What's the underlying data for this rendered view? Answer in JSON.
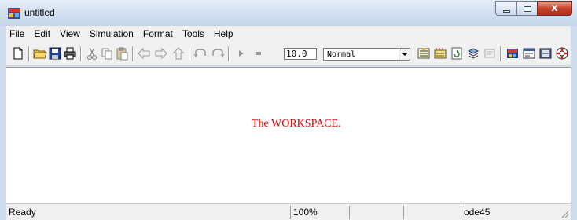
{
  "window": {
    "title": "untitled",
    "icons": {
      "app": "simulink-model-icon",
      "minimize": "minimize-icon",
      "maximize": "maximize-icon",
      "close": "close-icon",
      "close_glyph": "x"
    }
  },
  "menu": {
    "items": [
      "File",
      "Edit",
      "View",
      "Simulation",
      "Format",
      "Tools",
      "Help"
    ]
  },
  "toolbar": {
    "stop_time": "10.0",
    "simulation_mode": "Normal"
  },
  "canvas": {
    "label": "The WORKSPACE.",
    "label_color": "#e00000"
  },
  "status": {
    "state": "Ready",
    "zoom": "100%",
    "blank1": "",
    "blank2": "",
    "solver": "ode45"
  }
}
